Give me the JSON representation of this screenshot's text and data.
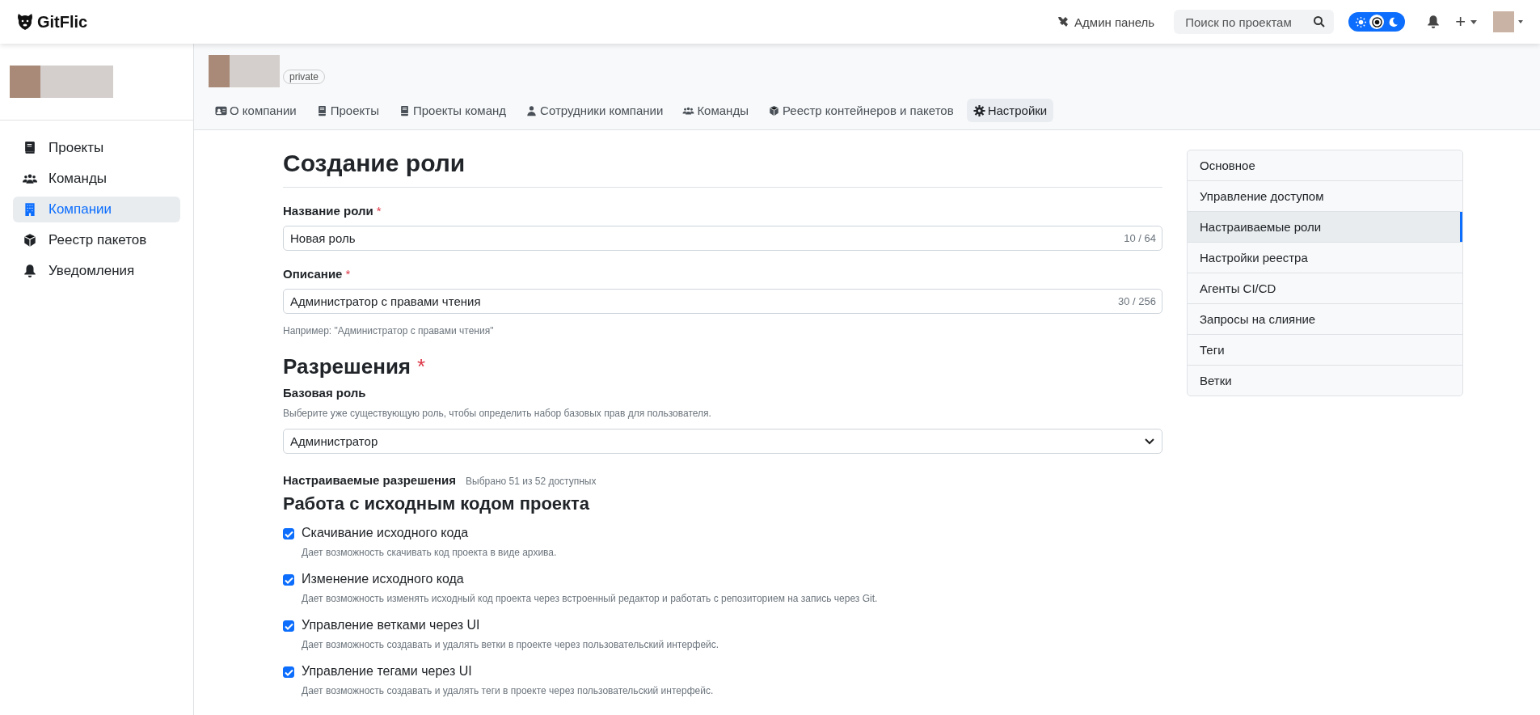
{
  "header": {
    "logo": "GitFlic",
    "admin_link": "Админ панель",
    "search": {
      "placeholder": "Поиск по проектам"
    },
    "theme_modes": [
      {
        "selected": false
      },
      {
        "selected": true
      },
      {
        "selected": false
      }
    ],
    "create_button": "+"
  },
  "sidebar": {
    "items": [
      {
        "label": "Проекты",
        "selected": false
      },
      {
        "label": "Команды",
        "selected": false
      },
      {
        "label": "Компании",
        "selected": true
      },
      {
        "label": "Реестр пакетов",
        "selected": false
      },
      {
        "label": "Уведомления",
        "selected": false
      }
    ]
  },
  "company": {
    "visibility": "private"
  },
  "tabs": [
    {
      "label": "О компании",
      "selected": false
    },
    {
      "label": "Проекты",
      "selected": false
    },
    {
      "label": "Проекты команд",
      "selected": false
    },
    {
      "label": "Сотрудники компании",
      "selected": false
    },
    {
      "label": "Команды",
      "selected": false
    },
    {
      "label": "Реестр контейнеров и пакетов",
      "selected": false
    },
    {
      "label": "Настройки",
      "selected": true
    }
  ],
  "form": {
    "title": "Создание роли",
    "fields": [
      {
        "label": "Название роли",
        "required_mark": "*",
        "value": "Новая роль",
        "counter": "10 / 64"
      },
      {
        "label": "Описание",
        "required_mark": "*",
        "value": "Администратор с правами чтения",
        "counter": "30 / 256",
        "hint": "Например: \"Администратор с правами чтения\""
      }
    ],
    "permissions": {
      "heading": "Разрешения",
      "required_mark": "*",
      "base_role": {
        "label": "Базовая роль",
        "hint": "Выберите уже существующую роль, чтобы определить набор базовых прав для пользователя.",
        "value": "Администратор"
      },
      "custom": {
        "label": "Настраиваемые разрешения",
        "summary": "Выбрано 51 из 52 доступных"
      },
      "group": {
        "title": "Работа с исходным кодом проекта",
        "items": [
          {
            "label": "Скачивание исходного кода",
            "description": "Дает возможность скачивать код проекта в виде архива.",
            "checked": true
          },
          {
            "label": "Изменение исходного кода",
            "description": "Дает возможность изменять исходный код проекта через встроенный редактор и работать с репозиторием на запись через Git.",
            "checked": true
          },
          {
            "label": "Управление ветками через UI",
            "description": "Дает возможность создавать и удалять ветки в проекте через пользовательский интерфейс.",
            "checked": true
          },
          {
            "label": "Управление тегами через UI",
            "description": "Дает возможность создавать и удалять теги в проекте через пользовательский интерфейс.",
            "checked": true
          }
        ]
      }
    }
  },
  "settings_menu": [
    {
      "label": "Основное",
      "selected": false
    },
    {
      "label": "Управление доступом",
      "selected": false
    },
    {
      "label": "Настраиваемые роли",
      "selected": true
    },
    {
      "label": "Настройки реестра",
      "selected": false
    },
    {
      "label": "Агенты CI/CD",
      "selected": false
    },
    {
      "label": "Запросы на слияние",
      "selected": false
    },
    {
      "label": "Теги",
      "selected": false
    },
    {
      "label": "Ветки",
      "selected": false
    }
  ]
}
